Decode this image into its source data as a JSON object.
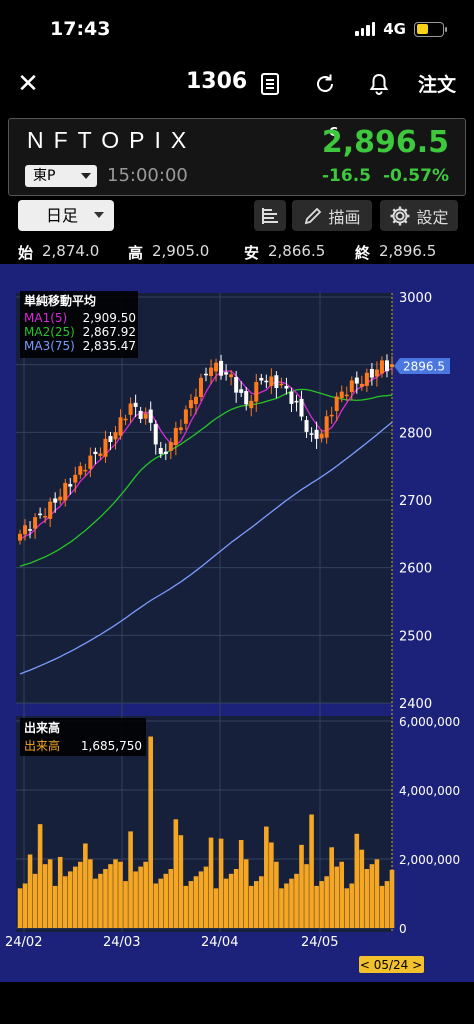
{
  "status": {
    "time": "17:43",
    "network": "4G"
  },
  "nav": {
    "code": "1306",
    "order_label": "注文"
  },
  "stock": {
    "name": "NFTOPIX",
    "market": "東P",
    "time": "15:00:00",
    "c_mark": "C",
    "price": "2,896.5",
    "change": "-16.5",
    "change_pct": "-0.57%"
  },
  "toolbar": {
    "period": "日足",
    "draw_label": "描画",
    "settings_label": "設定"
  },
  "ohlc": {
    "open_label": "始",
    "open": "2,874.0",
    "high_label": "高",
    "high": "2,905.0",
    "low_label": "安",
    "low": "2,866.5",
    "close_label": "終",
    "close": "2,896.5"
  },
  "colors": {
    "up": "#ff7a1a",
    "down": "#ffffff",
    "ma1": "#d62bd6",
    "ma2": "#27c427",
    "ma3": "#7a9cff",
    "volume": "#f5a623",
    "price_tag": "#4a78e0",
    "green": "#3ec83e",
    "background": "#1c2279"
  },
  "chart_data": [
    {
      "type": "candlestick",
      "legend_title": "単純移動平均",
      "ma": [
        {
          "name": "MA1(5)",
          "value": "2,909.50",
          "color": "#d62bd6"
        },
        {
          "name": "MA2(25)",
          "value": "2,867.92",
          "color": "#27c427"
        },
        {
          "name": "MA3(75)",
          "value": "2,835.47",
          "color": "#7a9cff"
        }
      ],
      "y_ticks": [
        "3000",
        "2900",
        "2800",
        "2700",
        "2600",
        "2500",
        "2400"
      ],
      "ylim": [
        2400,
        3000
      ],
      "current_price_tag": "2896.5",
      "x_labels": [
        "24/02",
        "24/03",
        "24/04",
        "24/05"
      ],
      "cursor_date": "< 05/24 >",
      "grid": true
    },
    {
      "type": "bar",
      "legend_title": "出来高",
      "series_label": "出来高",
      "current_value": "1,685,750",
      "y_ticks": [
        "6,000,000",
        "4,000,000",
        "2,000,000",
        "0"
      ],
      "ylim": [
        0,
        6000000
      ]
    }
  ]
}
